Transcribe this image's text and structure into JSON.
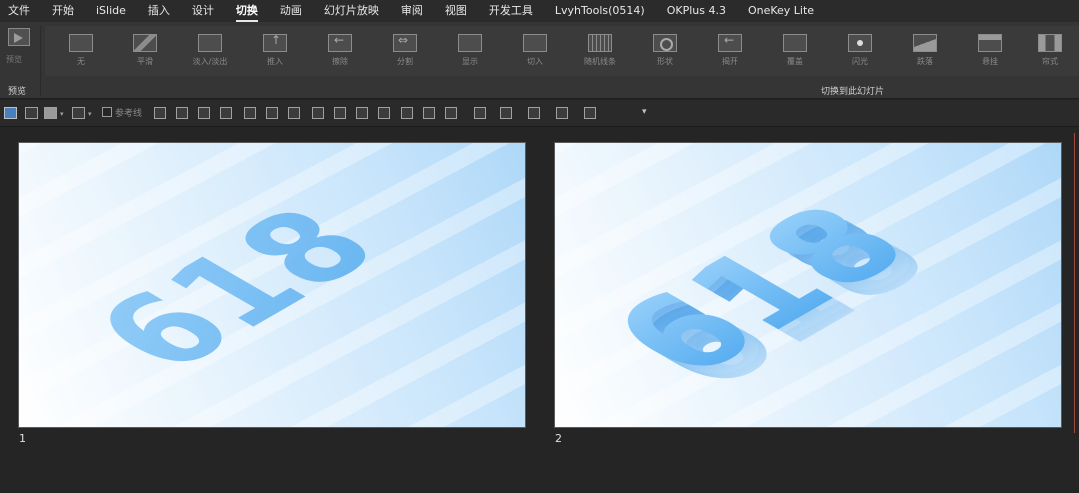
{
  "menubar": {
    "items": [
      "文件",
      "开始",
      "iSlide",
      "插入",
      "设计",
      "切换",
      "动画",
      "幻灯片放映",
      "审阅",
      "视图",
      "开发工具",
      "LvyhTools(0514)",
      "OKPlus 4.3",
      "OneKey Lite"
    ],
    "active": "切换"
  },
  "ribbon": {
    "preview_label": "预览",
    "preview_group_title": "预览",
    "transitions": [
      "无",
      "平滑",
      "淡入/淡出",
      "推入",
      "擦除",
      "分割",
      "显示",
      "切入",
      "随机线条",
      "形状",
      "揭开",
      "覆盖",
      "闪光",
      "跌落",
      "悬挂",
      "帘式"
    ],
    "transitions_group_title": "切换到此幻灯片"
  },
  "drawbar": {
    "reference_line_label": "参考线"
  },
  "slides": [
    {
      "number": "1",
      "art_text": "618"
    },
    {
      "number": "2",
      "art_text": "618"
    }
  ],
  "colors": {
    "accent_blue": "#5aaef0",
    "menu_bg": "#2b2b2b",
    "ribbon_bg": "#353535"
  }
}
